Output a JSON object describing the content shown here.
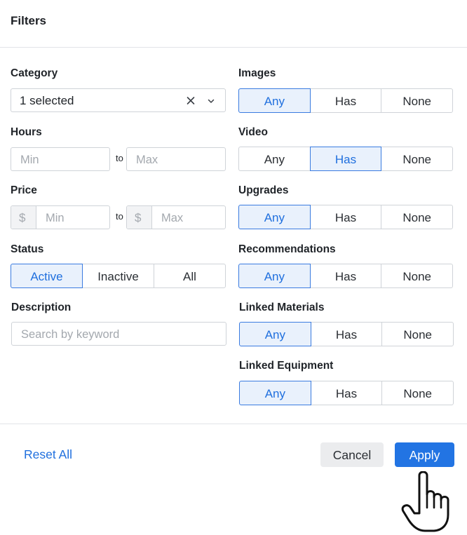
{
  "header": {
    "title": "Filters"
  },
  "category": {
    "label": "Category",
    "value": "1 selected"
  },
  "hours": {
    "label": "Hours",
    "min_placeholder": "Min",
    "to": "to",
    "max_placeholder": "Max"
  },
  "price": {
    "label": "Price",
    "currency": "$",
    "min_placeholder": "Min",
    "to": "to",
    "max_placeholder": "Max"
  },
  "status": {
    "label": "Status",
    "options": [
      "Active",
      "Inactive",
      "All"
    ],
    "selected": "Active"
  },
  "description": {
    "label": "Description",
    "placeholder": "Search by keyword"
  },
  "images": {
    "label": "Images",
    "options": [
      "Any",
      "Has",
      "None"
    ],
    "selected": "Any"
  },
  "video": {
    "label": "Video",
    "options": [
      "Any",
      "Has",
      "None"
    ],
    "selected": "Has"
  },
  "upgrades": {
    "label": "Upgrades",
    "options": [
      "Any",
      "Has",
      "None"
    ],
    "selected": "Any"
  },
  "recommendations": {
    "label": "Recommendations",
    "options": [
      "Any",
      "Has",
      "None"
    ],
    "selected": "Any"
  },
  "linked_materials": {
    "label": "Linked Materials",
    "options": [
      "Any",
      "Has",
      "None"
    ],
    "selected": "Any"
  },
  "linked_equipment": {
    "label": "Linked Equipment",
    "options": [
      "Any",
      "Has",
      "None"
    ],
    "selected": "Any"
  },
  "footer": {
    "reset_label": "Reset All",
    "cancel_label": "Cancel",
    "apply_label": "Apply"
  },
  "colors": {
    "accent": "#2274e3",
    "active_bg": "#e9f1fc",
    "border": "#cfd3d8"
  },
  "icons": {
    "clear": "close-icon",
    "dropdown": "chevron-down-icon",
    "cursor": "hand-pointer-icon"
  }
}
